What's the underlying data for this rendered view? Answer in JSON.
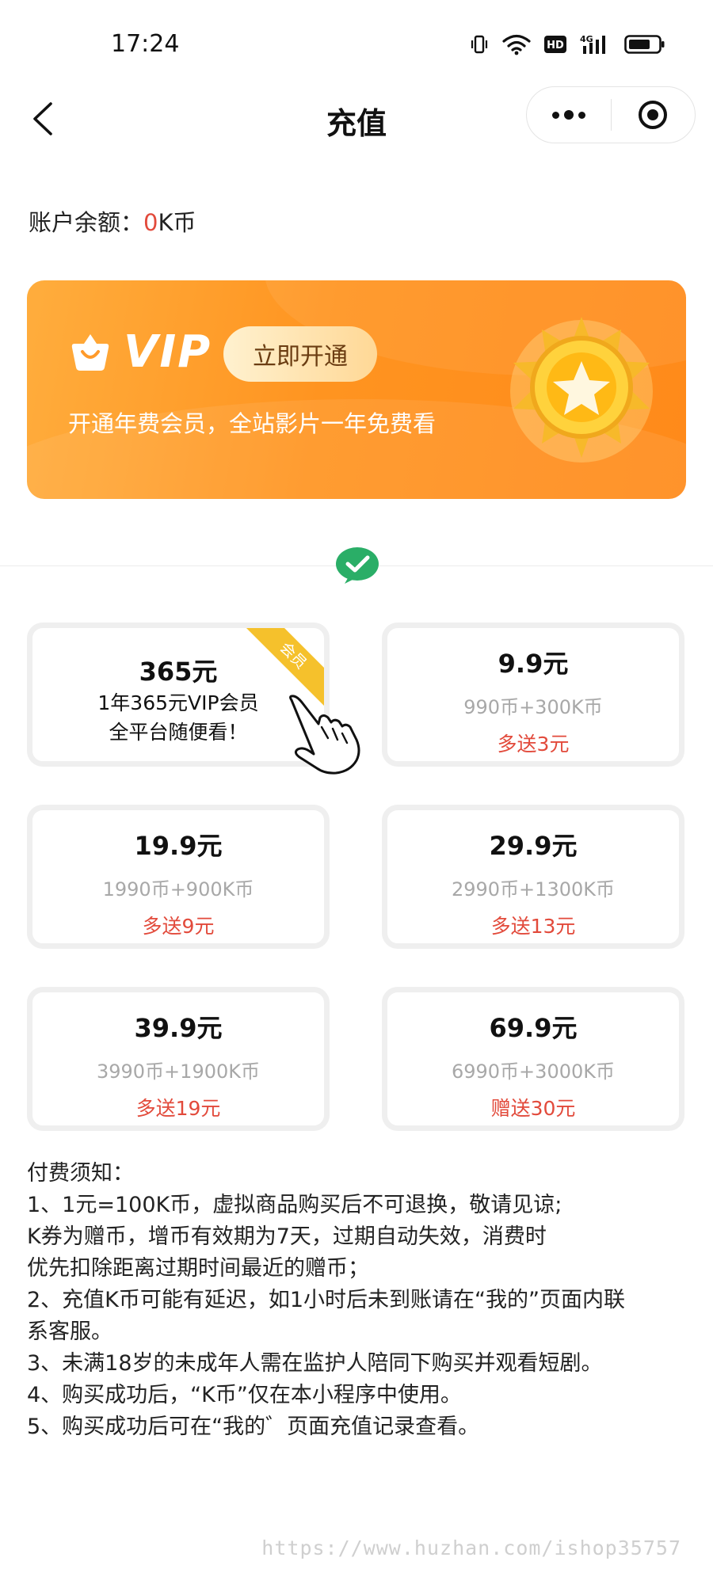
{
  "status_bar": {
    "time": "17:24",
    "network_label": "4G",
    "hd_label": "HD",
    "icons": [
      "vibrate-icon",
      "wifi-icon",
      "hd-icon",
      "signal-4g-icon",
      "battery-icon"
    ]
  },
  "nav": {
    "title": "充值",
    "back_icon": "chevron-left-icon",
    "more_icon": "more-dots-icon",
    "close_icon": "target-close-icon"
  },
  "balance": {
    "label": "账户余额：",
    "amount": "0",
    "unit": "K币"
  },
  "vip_banner": {
    "title": "VIP",
    "button_label": "立即开通",
    "description": "开通年费会员，全站影片一年免费看",
    "logo_icon": "vip-bag-icon",
    "medal_icon": "gold-star-medal-icon",
    "colors": {
      "start": "#ffad3d",
      "end": "#ff8a1a",
      "button_text": "#6b3d12"
    }
  },
  "payment_method": {
    "icon": "wechat-pay-icon",
    "color": "#2aae67"
  },
  "packages": [
    {
      "price": "365元",
      "desc_line1": "1年365元VIP会员",
      "desc_line2": "全平台随便看！",
      "ribbon": "会员"
    },
    {
      "price": "9.9元",
      "coins": "990币+300K币",
      "bonus": "多送3元"
    },
    {
      "price": "19.9元",
      "coins": "1990币+900K币",
      "bonus": "多送9元"
    },
    {
      "price": "29.9元",
      "coins": "2990币+1300K币",
      "bonus": "多送13元"
    },
    {
      "price": "39.9元",
      "coins": "3990币+1900K币",
      "bonus": "多送19元"
    },
    {
      "price": "69.9元",
      "coins": "6990币+3000K币",
      "bonus": "赠送30元"
    }
  ],
  "pointer_icon": "pointing-hand-icon",
  "notice": {
    "lines": [
      "付费须知：",
      "1、1元=100K币，虚拟商品购买后不可退换，敬请见谅;",
      "K券为赠币，增币有效期为7天，过期自动失效，消费时",
      "优先扣除距离过期时间最近的赠币；",
      "2、充值K币可能有延迟，如1小时后未到账请在“我的”页面内联",
      "系客服。",
      "3、未满18岁的未成年人需在监护人陪同下购买并观看短剧。",
      "4、购买成功后，“K币”仅在本小程序中使用。",
      "5、购买成功后可在“我的゛页面充值记录查看。"
    ]
  },
  "watermark": "https://www.huzhan.com/ishop35757",
  "colors": {
    "accent_red": "#e24a3b",
    "muted_gray": "#a8a8a8",
    "card_border": "#efefef"
  }
}
